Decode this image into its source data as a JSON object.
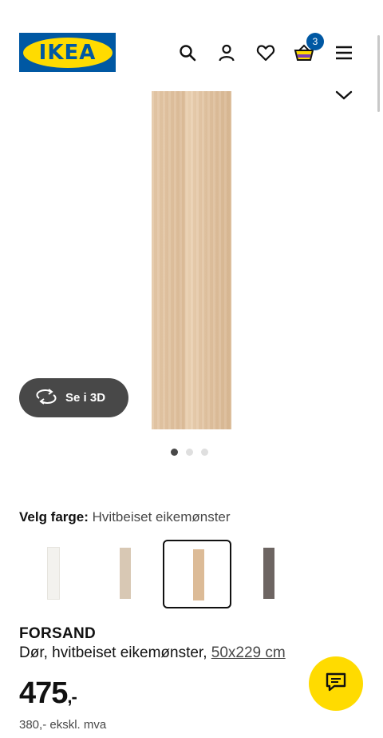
{
  "header": {
    "logo_text": "IKEA",
    "cart_count": "3",
    "brand_blue": "#0058a3",
    "brand_yellow": "#ffdb00"
  },
  "gallery": {
    "view3d_label": "Se i 3D",
    "dots": 3,
    "active_dot": 0
  },
  "color_picker": {
    "label": "Velg farge:",
    "value": "Hvitbeiset eikemønster",
    "swatches": [
      {
        "name": "hvit",
        "color": "#f3f2ee"
      },
      {
        "name": "beige",
        "color": "#d8c8b4"
      },
      {
        "name": "hvitbeiset eik",
        "color": "#dcbb97",
        "selected": true
      },
      {
        "name": "grå",
        "color": "#6d6562"
      }
    ]
  },
  "product": {
    "name": "FORSAND",
    "description": "Dør, hvitbeiset eikemønster,",
    "dimensions": "50x229 cm",
    "price": "475",
    "price_suffix": ",-",
    "price_ex_vat": "380,- ekskl. mva"
  }
}
